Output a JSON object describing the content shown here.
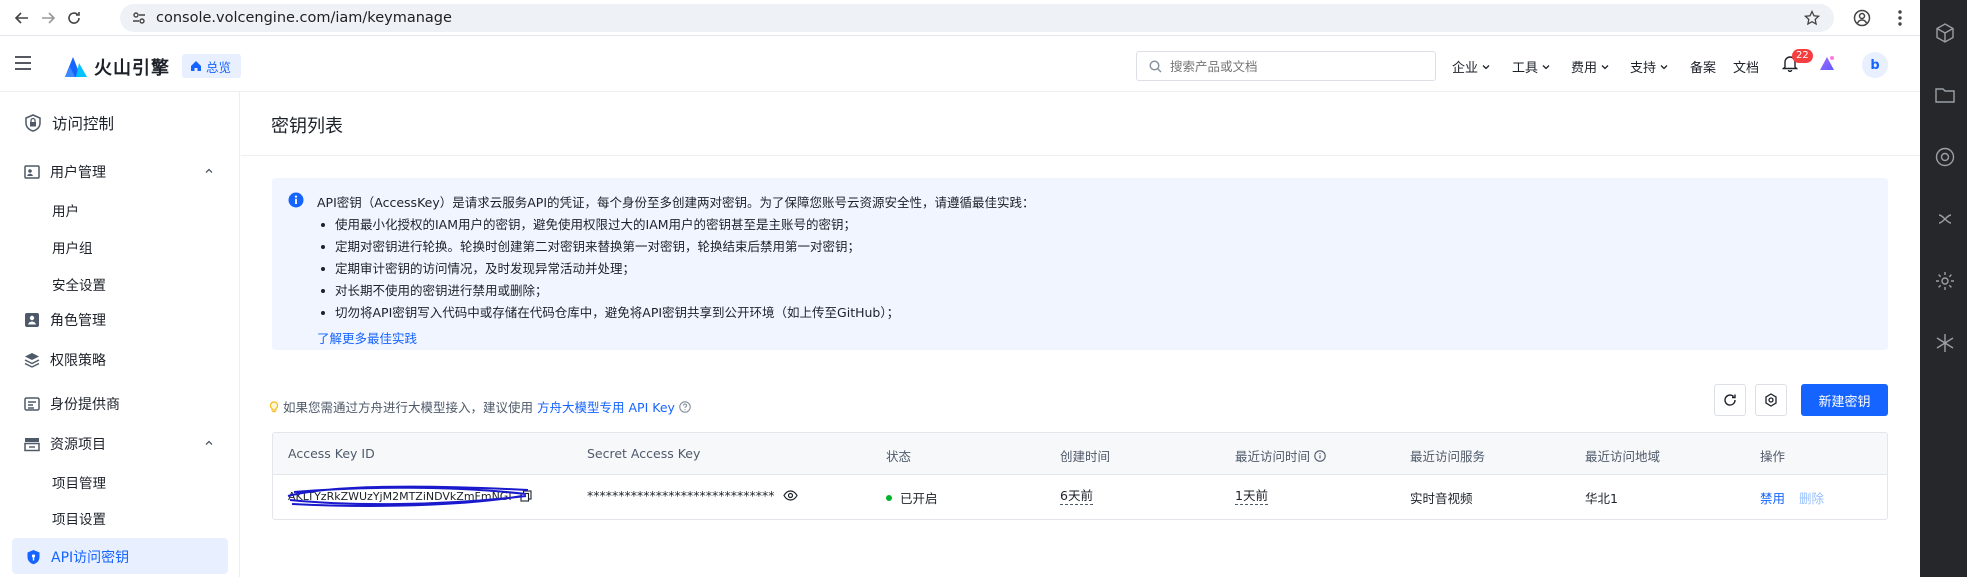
{
  "browser": {
    "url": "console.volcengine.com/iam/keymanage"
  },
  "header": {
    "brand": "火山引擎",
    "overview": "总览",
    "search_placeholder": "搜索产品或文档",
    "menus": [
      "企业",
      "工具",
      "费用",
      "支持"
    ],
    "links": [
      "备案",
      "文档"
    ],
    "notification_count": "22",
    "avatar_letter": "b"
  },
  "sidebar": {
    "title": "访问控制",
    "groups": [
      {
        "label": "用户管理",
        "expanded": true,
        "children": [
          "用户",
          "用户组",
          "安全设置"
        ]
      },
      {
        "label": "角色管理"
      },
      {
        "label": "权限策略"
      },
      {
        "label": "身份提供商"
      },
      {
        "label": "资源项目",
        "expanded": true,
        "children": [
          "项目管理",
          "项目设置"
        ]
      },
      {
        "label": "API访问密钥",
        "active": true
      }
    ]
  },
  "main": {
    "title": "密钥列表",
    "alert": {
      "intro": "API密钥（AccessKey）是请求云服务API的凭证，每个身份至多创建两对密钥。为了保障您账号云资源安全性，请遵循最佳实践：",
      "items": [
        "使用最小化授权的IAM用户的密钥，避免使用权限过大的IAM用户的密钥甚至是主账号的密钥；",
        "定期对密钥进行轮换。轮换时创建第二对密钥来替换第一对密钥，轮换结束后禁用第一对密钥；",
        "定期审计密钥的访问情况，及时发现异常活动并处理；",
        "对长期不使用的密钥进行禁用或删除；",
        "切勿将API密钥写入代码中或存储在代码仓库中，避免将API密钥共享到公开环境（如上传至GitHub）；"
      ],
      "link": "了解更多最佳实践"
    },
    "tip": {
      "text": "如果您需通过方舟进行大模型接入，建议使用",
      "link": "方舟大模型专用 API Key"
    },
    "create_button": "新建密钥",
    "table": {
      "columns": [
        "Access Key ID",
        "Secret Access Key",
        "状态",
        "创建时间",
        "最近访问时间",
        "最近访问服务",
        "最近访问地域",
        "操作"
      ],
      "rows": [
        {
          "access_key_id": "AKLTYzRkZWUzYjM2MTZiNDVkZmFmNGI",
          "secret_access_key": "******************************",
          "status": "已开启",
          "created": "6天前",
          "last_access": "1天前",
          "last_service": "实时音视频",
          "last_region": "华北1",
          "actions": [
            "禁用",
            "删除"
          ]
        }
      ]
    }
  },
  "colors": {
    "primary": "#1664ff",
    "alert_bg": "#f0f5ff",
    "status_on": "#00b42a",
    "badge": "#f53f3f"
  }
}
